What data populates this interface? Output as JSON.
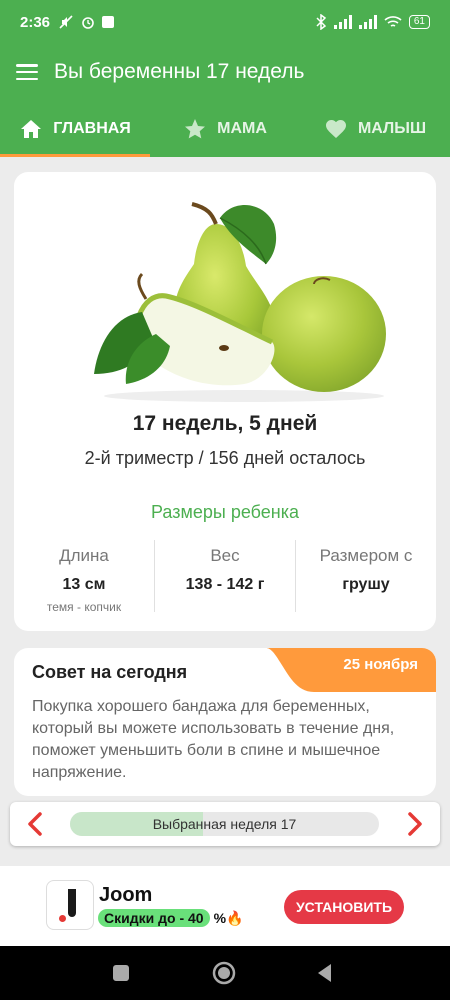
{
  "status": {
    "time": "2:36",
    "battery": "61"
  },
  "appbar": {
    "title": "Вы беременны 17 недель"
  },
  "tabs": [
    {
      "label": "ГЛАВНАЯ",
      "icon": "home-icon"
    },
    {
      "label": "МАМА",
      "icon": "star-icon"
    },
    {
      "label": "МАЛЫШ",
      "icon": "heart-icon"
    }
  ],
  "main": {
    "week_title": "17 недель, 5 дней",
    "trimester": "2-й триместр / 156 дней осталось",
    "size_title": "Размеры ребенка",
    "stats": [
      {
        "label": "Длина",
        "value": "13 см",
        "sub": "темя - копчик"
      },
      {
        "label": "Вес",
        "value": "138 - 142 г",
        "sub": ""
      },
      {
        "label": "Размером с",
        "value": "грушу",
        "sub": ""
      }
    ]
  },
  "advice": {
    "title": "Совет на сегодня",
    "date": "25 ноября",
    "text": "Покупка хорошего бандажа для беременных, который вы можете использовать в течение дня, поможет уменьшить боли в спине и мышечное напряжение."
  },
  "week_selector": {
    "label": "Выбранная неделя 17",
    "progress": 0.43
  },
  "ad": {
    "name": "Joom",
    "promo_pill": "Скидки до - 40",
    "promo_rest": "%🔥",
    "button": "УСТАНОВИТЬ"
  },
  "colors": {
    "accent": "#4caf50",
    "tab_indicator": "#ff9a3c",
    "date_badge": "#ff9a3c",
    "arrow": "#e53935",
    "ad_button": "#e53946"
  }
}
